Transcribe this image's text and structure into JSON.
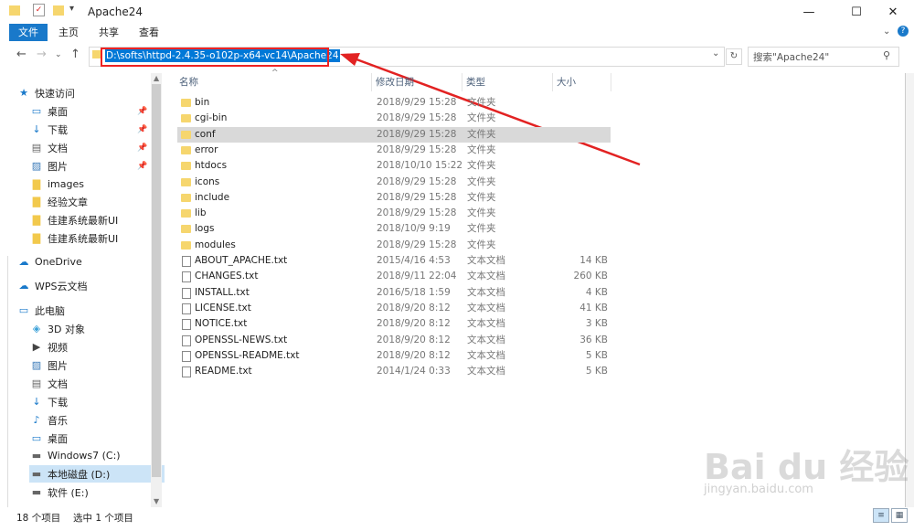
{
  "window": {
    "title": "Apache24"
  },
  "ribbon": {
    "file": "文件",
    "tabs": [
      "主页",
      "共享",
      "查看"
    ]
  },
  "address": {
    "path": "D:\\softs\\httpd-2.4.35-o102p-x64-vc14\\Apache24"
  },
  "search": {
    "placeholder": "搜索\"Apache24\""
  },
  "sidebar": {
    "items": [
      {
        "label": "快速访问",
        "icon": "star-icon"
      },
      {
        "label": "桌面",
        "icon": "desktop-icon",
        "pinned": true
      },
      {
        "label": "下载",
        "icon": "download-icon",
        "pinned": true
      },
      {
        "label": "文档",
        "icon": "documents-icon",
        "pinned": true
      },
      {
        "label": "图片",
        "icon": "pictures-icon",
        "pinned": true
      },
      {
        "label": "images",
        "icon": "folder-icon"
      },
      {
        "label": "经验文章",
        "icon": "folder-icon"
      },
      {
        "label": "佳建系统最新UI",
        "icon": "folder-icon"
      },
      {
        "label": "佳建系统最新UI",
        "icon": "folder-icon"
      },
      {
        "label": "OneDrive",
        "icon": "cloud-icon"
      },
      {
        "label": "WPS云文档",
        "icon": "cloud-icon"
      },
      {
        "label": "此电脑",
        "icon": "pc-icon"
      },
      {
        "label": "3D 对象",
        "icon": "3d-icon"
      },
      {
        "label": "视频",
        "icon": "video-icon"
      },
      {
        "label": "图片",
        "icon": "pictures-icon"
      },
      {
        "label": "文档",
        "icon": "documents-icon"
      },
      {
        "label": "下载",
        "icon": "download-icon"
      },
      {
        "label": "音乐",
        "icon": "music-icon"
      },
      {
        "label": "桌面",
        "icon": "desktop-icon"
      },
      {
        "label": "Windows7 (C:)",
        "icon": "drive-icon"
      },
      {
        "label": "本地磁盘 (D:)",
        "icon": "drive-icon",
        "selected": true
      },
      {
        "label": "软件 (E:)",
        "icon": "drive-icon"
      }
    ]
  },
  "columns": {
    "name": "名称",
    "date": "修改日期",
    "type": "类型",
    "size": "大小"
  },
  "files": [
    {
      "name": "bin",
      "date": "2018/9/29 15:28",
      "type": "文件夹",
      "size": "",
      "kind": "folder"
    },
    {
      "name": "cgi-bin",
      "date": "2018/9/29 15:28",
      "type": "文件夹",
      "size": "",
      "kind": "folder"
    },
    {
      "name": "conf",
      "date": "2018/9/29 15:28",
      "type": "文件夹",
      "size": "",
      "kind": "folder",
      "selected": true
    },
    {
      "name": "error",
      "date": "2018/9/29 15:28",
      "type": "文件夹",
      "size": "",
      "kind": "folder"
    },
    {
      "name": "htdocs",
      "date": "2018/10/10 15:22",
      "type": "文件夹",
      "size": "",
      "kind": "folder"
    },
    {
      "name": "icons",
      "date": "2018/9/29 15:28",
      "type": "文件夹",
      "size": "",
      "kind": "folder"
    },
    {
      "name": "include",
      "date": "2018/9/29 15:28",
      "type": "文件夹",
      "size": "",
      "kind": "folder"
    },
    {
      "name": "lib",
      "date": "2018/9/29 15:28",
      "type": "文件夹",
      "size": "",
      "kind": "folder"
    },
    {
      "name": "logs",
      "date": "2018/10/9 9:19",
      "type": "文件夹",
      "size": "",
      "kind": "folder"
    },
    {
      "name": "modules",
      "date": "2018/9/29 15:28",
      "type": "文件夹",
      "size": "",
      "kind": "folder"
    },
    {
      "name": "ABOUT_APACHE.txt",
      "date": "2015/4/16 4:53",
      "type": "文本文档",
      "size": "14 KB",
      "kind": "doc"
    },
    {
      "name": "CHANGES.txt",
      "date": "2018/9/11 22:04",
      "type": "文本文档",
      "size": "260 KB",
      "kind": "doc"
    },
    {
      "name": "INSTALL.txt",
      "date": "2016/5/18 1:59",
      "type": "文本文档",
      "size": "4 KB",
      "kind": "doc"
    },
    {
      "name": "LICENSE.txt",
      "date": "2018/9/20 8:12",
      "type": "文本文档",
      "size": "41 KB",
      "kind": "doc"
    },
    {
      "name": "NOTICE.txt",
      "date": "2018/9/20 8:12",
      "type": "文本文档",
      "size": "3 KB",
      "kind": "doc"
    },
    {
      "name": "OPENSSL-NEWS.txt",
      "date": "2018/9/20 8:12",
      "type": "文本文档",
      "size": "36 KB",
      "kind": "doc"
    },
    {
      "name": "OPENSSL-README.txt",
      "date": "2018/9/20 8:12",
      "type": "文本文档",
      "size": "5 KB",
      "kind": "doc"
    },
    {
      "name": "README.txt",
      "date": "2014/1/24 0:33",
      "type": "文本文档",
      "size": "5 KB",
      "kind": "doc"
    }
  ],
  "status": {
    "count": "18 个项目",
    "selected": "选中 1 个项目"
  },
  "watermark": {
    "main": "Bai du 经验",
    "url": "jingyan.baidu.com"
  },
  "colors": {
    "accent": "#1979ca",
    "selection": "#0078d7",
    "annotation": "#e22222"
  }
}
